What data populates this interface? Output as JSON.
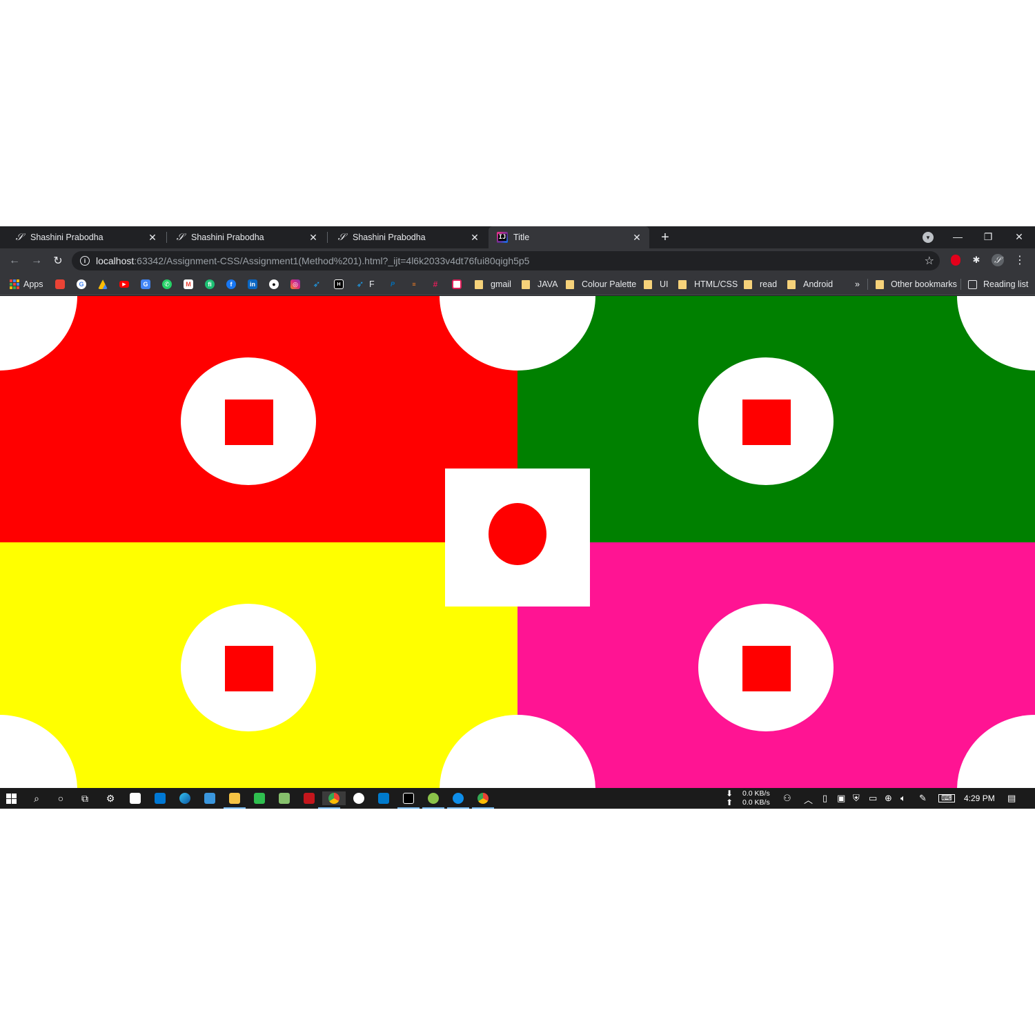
{
  "tabs": [
    {
      "title": "Shashini Prabodha",
      "icon": "shashini-favicon"
    },
    {
      "title": "Shashini Prabodha",
      "icon": "shashini-favicon"
    },
    {
      "title": "Shashini Prabodha",
      "icon": "shashini-favicon"
    },
    {
      "title": "Title",
      "icon": "intellij-favicon",
      "active": true
    }
  ],
  "address_bar": {
    "host": "localhost",
    "rest": ":63342/Assignment-CSS/Assignment1(Method%201).html?_ijt=4l6k2033v4dt76fui80qigh5p5"
  },
  "bookmarks": {
    "apps_label": "Apps",
    "site_icons": [
      "google-drive-files-icon",
      "google-icon",
      "google-drive-icon",
      "youtube-icon",
      "google-translate-icon",
      "whatsapp-icon",
      "gmail-icon",
      "fiverr-icon",
      "facebook-icon",
      "linkedin-icon",
      "github-icon",
      "instagram-icon",
      "twitter-icon",
      "hackerrank-icon"
    ],
    "f_label": "F",
    "folders": [
      "gmail",
      "JAVA",
      "Colour Palette",
      "UI",
      "HTML/CSS",
      "read",
      "Android"
    ],
    "overflow": "»",
    "other": "Other bookmarks",
    "reading_list": "Reading list"
  },
  "page": {
    "colors": {
      "top_left": "#ff0000",
      "top_right": "#008000",
      "bottom_left": "#ffff00",
      "bottom_right": "#ff1493",
      "circle": "#ffffff",
      "square": "#ff0000",
      "center_box": "#ffffff",
      "center_dot": "#ff0000"
    }
  },
  "taskbar": {
    "net_down": "0.0 KB/s",
    "net_up": "0.0 KB/s",
    "time": "4:29 PM"
  }
}
